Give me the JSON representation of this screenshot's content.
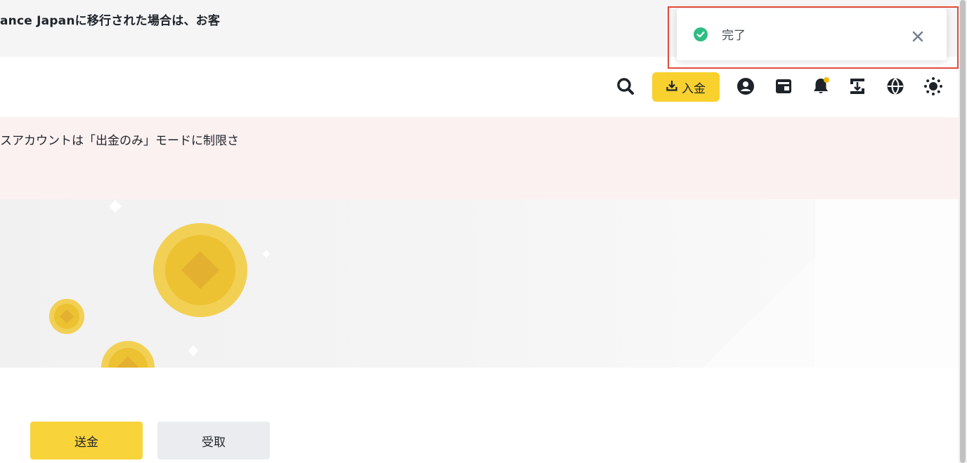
{
  "banner": {
    "text": "ance Japanに移行された場合は、お客"
  },
  "header": {
    "deposit_label": "入金",
    "icons": [
      "search-icon",
      "download-icon",
      "account-icon",
      "wallet-icon",
      "bell-icon",
      "transfer-icon",
      "globe-icon",
      "theme-icon"
    ]
  },
  "alert": {
    "text": "スアカウントは「出金のみ」モードに制限さ"
  },
  "actions": {
    "send_label": "送金",
    "receive_label": "受取"
  },
  "toast": {
    "message": "完了",
    "status": "success"
  },
  "colors": {
    "accent": "#f8d12f",
    "alert_bg": "#fcf1f1",
    "success": "#2ebd85",
    "highlight": "#e24b3b"
  }
}
